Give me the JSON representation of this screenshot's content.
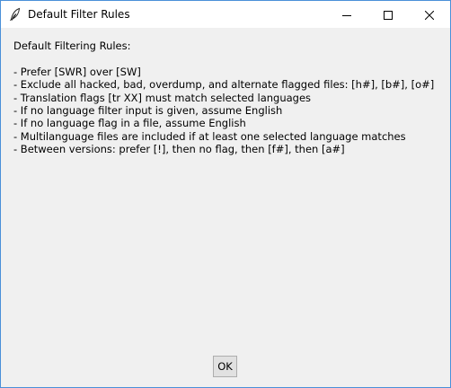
{
  "window": {
    "title": "Default Filter Rules",
    "icon": "feather-icon",
    "controls": {
      "minimize": "minimize-icon",
      "maximize": "maximize-icon",
      "close": "close-icon"
    }
  },
  "content": {
    "heading": "Default Filtering Rules:",
    "rules": [
      "- Prefer [SWR] over [SW]",
      "- Exclude all hacked, bad, overdump, and alternate flagged files: [h#], [b#], [o#]",
      "- Translation flags [tr XX] must match selected languages",
      "- If no language filter input is given, assume English",
      "- If no language flag in a file, assume English",
      "- Multilanguage files are included if at least one selected language matches",
      "- Between versions: prefer [!], then no flag, then [f#], then [a#]"
    ]
  },
  "buttons": {
    "ok_label": "OK"
  },
  "colors": {
    "window_border": "#4a90d9",
    "titlebar_bg": "#ffffff",
    "client_bg": "#f0f0f0",
    "button_bg": "#e1e1e1",
    "button_border": "#adadad"
  }
}
